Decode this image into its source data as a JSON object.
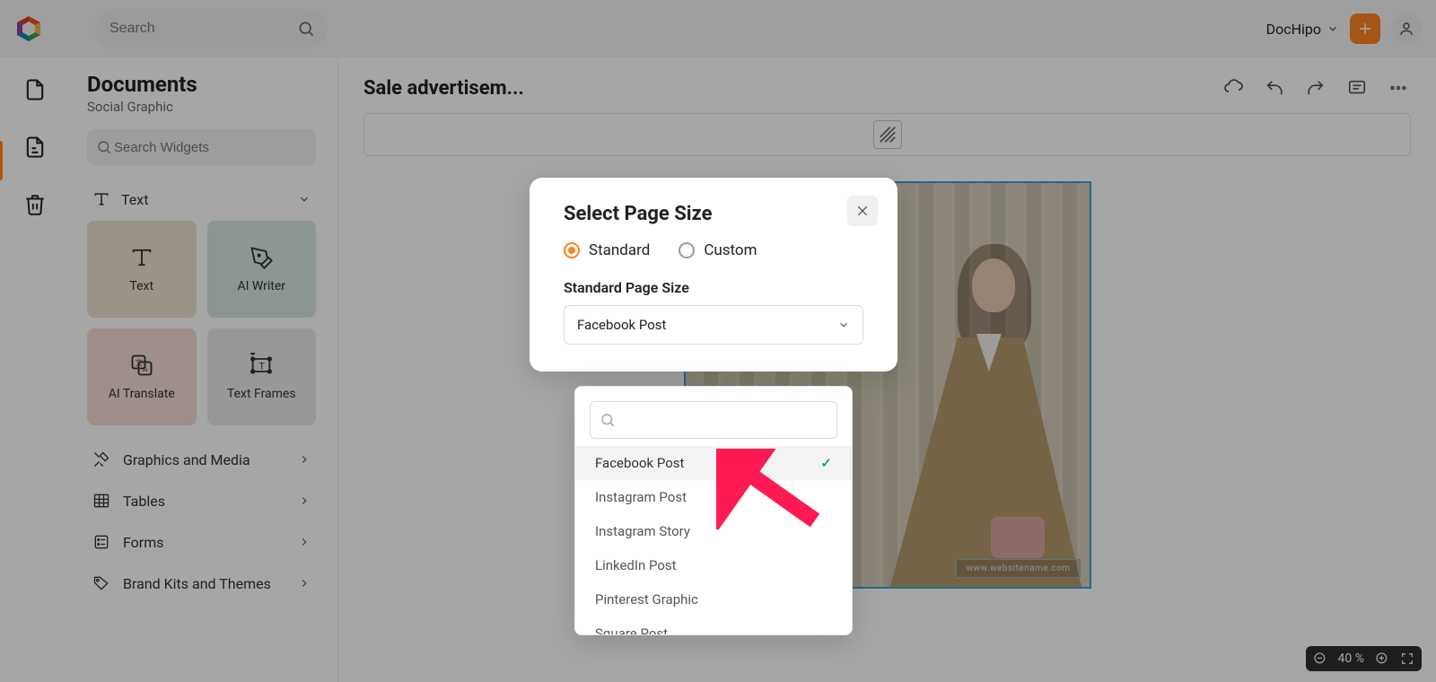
{
  "colors": {
    "accent": "#fd8322",
    "selection": "#35a6d6",
    "check": "#21a85a"
  },
  "topbar": {
    "search_placeholder": "Search",
    "user_label": "DocHipo"
  },
  "panel": {
    "title": "Documents",
    "subtitle": "Social Graphic",
    "widget_search_placeholder": "Search Widgets",
    "accordion_text": "Text",
    "tiles": {
      "text": "Text",
      "ai_writer": "AI Writer",
      "ai_translate": "AI Translate",
      "text_frames": "Text Frames"
    },
    "rows": {
      "graphics": "Graphics and Media",
      "tables": "Tables",
      "forms": "Forms",
      "brand": "Brand Kits and Themes"
    }
  },
  "canvas": {
    "title": "Sale advertisem...",
    "artboard": {
      "url_tag": "www.websitename.com"
    },
    "zoom": {
      "value": "40 %"
    }
  },
  "modal": {
    "title": "Select Page Size",
    "radio_standard": "Standard",
    "radio_custom": "Custom",
    "size_label": "Standard Page Size",
    "selected_value": "Facebook Post",
    "options": [
      "Facebook Post",
      "Instagram Post",
      "Instagram Story",
      "LinkedIn Post",
      "Pinterest Graphic",
      "Square Post"
    ]
  }
}
